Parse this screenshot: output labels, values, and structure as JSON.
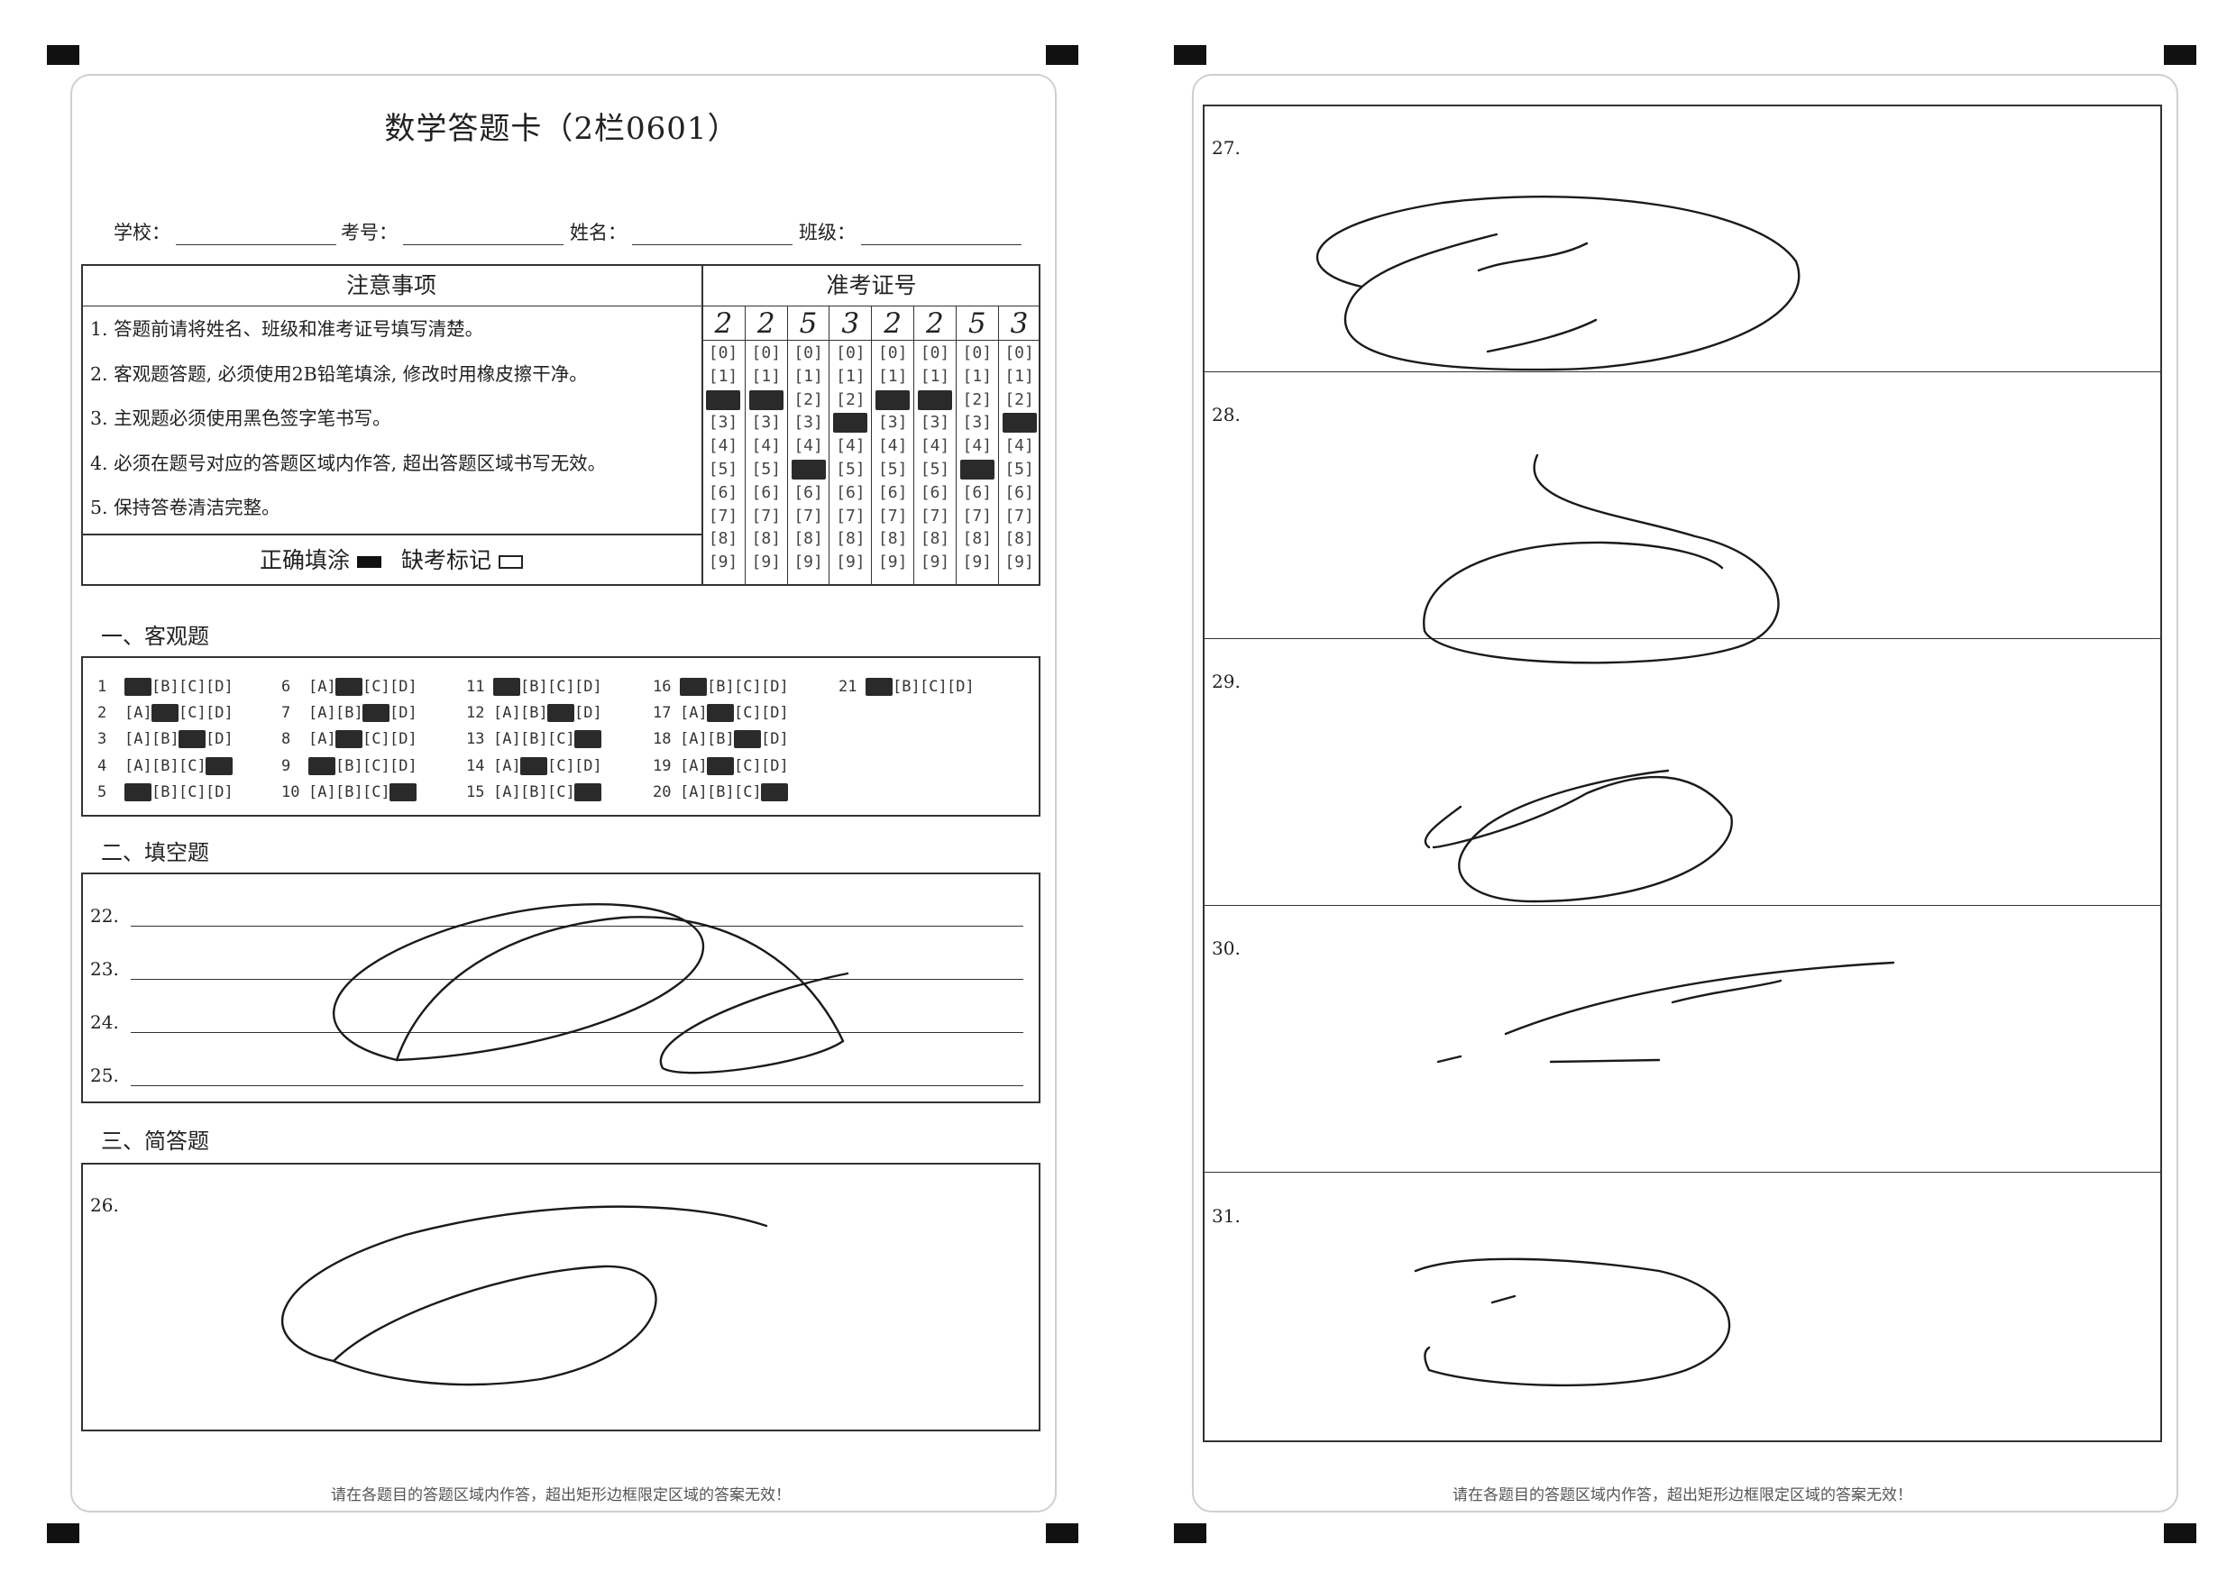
{
  "title": "数学答题卡（2栏0601）",
  "fields": [
    {
      "label": "学校："
    },
    {
      "label": "考号："
    },
    {
      "label": "姓名："
    },
    {
      "label": "班级："
    }
  ],
  "notice": {
    "heading": "注意事项",
    "items": [
      "1.  答题前请将姓名、班级和准考证号填写清楚。",
      "2.  客观题答题, 必须使用2B铅笔填涂, 修改时用橡皮擦干净。",
      "3.  主观题必须使用黑色签字笔书写。",
      "4.  必须在题号对应的答题区域内作答, 超出答题区域书写无效。",
      "5.  保持答卷清洁完整。"
    ]
  },
  "fill_legend": {
    "correct": "正确填涂",
    "absent": "缺考标记"
  },
  "exam_number": {
    "heading": "准考证号",
    "handwritten": [
      "2",
      "2",
      "5",
      "3",
      "2",
      "2",
      "5",
      "3"
    ],
    "options": [
      "[0]",
      "[1]",
      "[2]",
      "[3]",
      "[4]",
      "[5]",
      "[6]",
      "[7]",
      "[8]",
      "[9]"
    ],
    "filled_digits": [
      2,
      2,
      5,
      3,
      2,
      2,
      5,
      3
    ]
  },
  "sections": {
    "objective": "一、客观题",
    "fill_blank": "二、填空题",
    "short_answer": "三、简答题"
  },
  "objective_questions": [
    {
      "num": "1",
      "choices": [
        "[A]",
        "[B]",
        "[C]",
        "[D]"
      ],
      "filled": 0
    },
    {
      "num": "2",
      "choices": [
        "[A]",
        "[B]",
        "[C]",
        "[D]"
      ],
      "filled": 1
    },
    {
      "num": "3",
      "choices": [
        "[A]",
        "[B]",
        "[C]",
        "[D]"
      ],
      "filled": 2
    },
    {
      "num": "4",
      "choices": [
        "[A]",
        "[B]",
        "[C]",
        "[D]"
      ],
      "filled": 3
    },
    {
      "num": "5",
      "choices": [
        "[A]",
        "[B]",
        "[C]",
        "[D]"
      ],
      "filled": 0
    },
    {
      "num": "6",
      "choices": [
        "[A]",
        "[B]",
        "[C]",
        "[D]"
      ],
      "filled": 1
    },
    {
      "num": "7",
      "choices": [
        "[A]",
        "[B]",
        "[C]",
        "[D]"
      ],
      "filled": 2
    },
    {
      "num": "8",
      "choices": [
        "[A]",
        "[B]",
        "[C]",
        "[D]"
      ],
      "filled": 1
    },
    {
      "num": "9",
      "choices": [
        "[A]",
        "[B]",
        "[C]",
        "[D]"
      ],
      "filled": 0
    },
    {
      "num": "10",
      "choices": [
        "[A]",
        "[B]",
        "[C]",
        "[D]"
      ],
      "filled": 3
    },
    {
      "num": "11",
      "choices": [
        "[A]",
        "[B]",
        "[C]",
        "[D]"
      ],
      "filled": 0
    },
    {
      "num": "12",
      "choices": [
        "[A]",
        "[B]",
        "[C]",
        "[D]"
      ],
      "filled": 2
    },
    {
      "num": "13",
      "choices": [
        "[A]",
        "[B]",
        "[C]",
        "[D]"
      ],
      "filled": 3
    },
    {
      "num": "14",
      "choices": [
        "[A]",
        "[B]",
        "[C]",
        "[D]"
      ],
      "filled": 1
    },
    {
      "num": "15",
      "choices": [
        "[A]",
        "[B]",
        "[C]",
        "[D]"
      ],
      "filled": 3
    },
    {
      "num": "16",
      "choices": [
        "[A]",
        "[B]",
        "[C]",
        "[D]"
      ],
      "filled": 0
    },
    {
      "num": "17",
      "choices": [
        "[A]",
        "[B]",
        "[C]",
        "[D]"
      ],
      "filled": 1
    },
    {
      "num": "18",
      "choices": [
        "[A]",
        "[B]",
        "[C]",
        "[D]"
      ],
      "filled": 2
    },
    {
      "num": "19",
      "choices": [
        "[A]",
        "[B]",
        "[C]",
        "[D]"
      ],
      "filled": 1
    },
    {
      "num": "20",
      "choices": [
        "[A]",
        "[B]",
        "[C]",
        "[D]"
      ],
      "filled": 3
    },
    {
      "num": "21",
      "choices": [
        "[A]",
        "[B]",
        "[C]",
        "[D]"
      ],
      "filled": 0
    }
  ],
  "fill_blank_questions": [
    "22.",
    "23.",
    "24.",
    "25."
  ],
  "short_answer_questions": [
    "26.",
    "27.",
    "28.",
    "29.",
    "30.",
    "31."
  ],
  "footer_note": "请在各题目的答题区域内作答，超出矩形边框限定区域的答案无效！"
}
